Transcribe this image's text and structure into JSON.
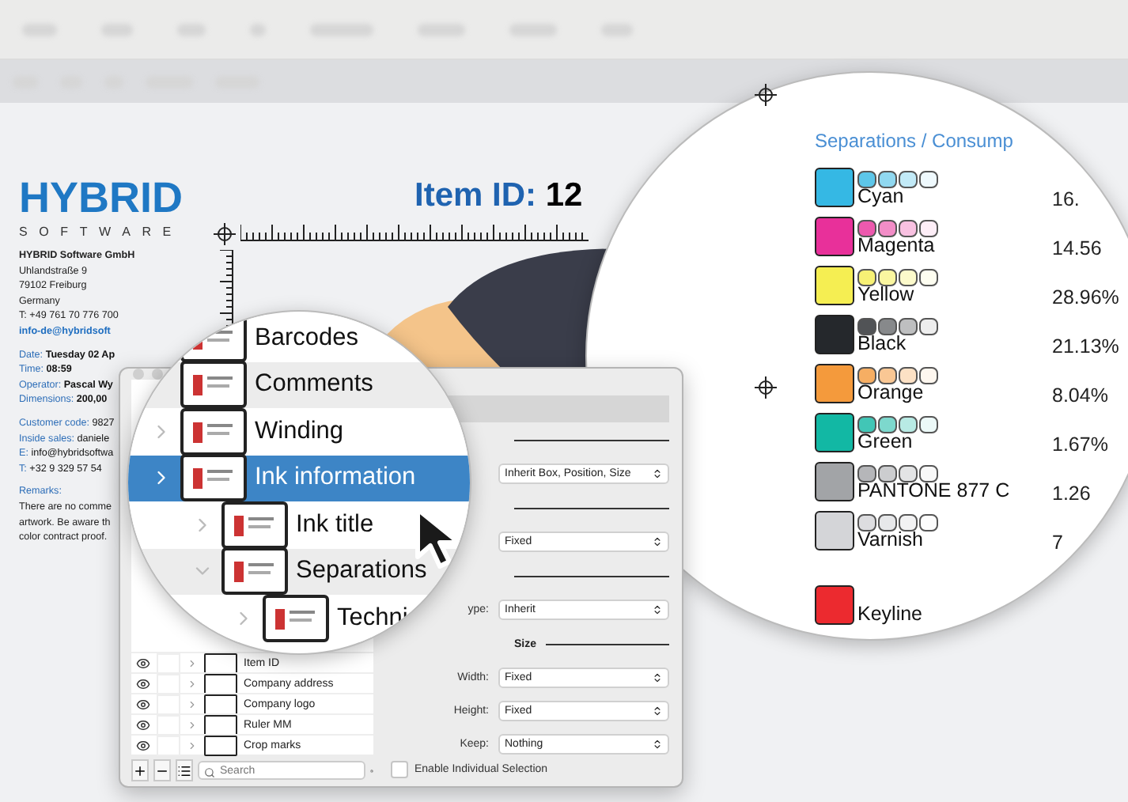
{
  "document": {
    "logo": {
      "name": "HYBRID",
      "tagline": "SOFTWARE"
    },
    "item_id": {
      "label": "Item ID:",
      "value": "12"
    },
    "address": [
      {
        "kind": "company",
        "text": "HYBRID Software GmbH"
      },
      {
        "kind": "line",
        "text": "Uhlandstraße 9"
      },
      {
        "kind": "line",
        "text": "79102 Freiburg"
      },
      {
        "kind": "line",
        "text": "Germany"
      },
      {
        "kind": "line",
        "text": "T: +49 761 70 776 700"
      },
      {
        "kind": "email",
        "text": "info-de@hybridsoft"
      }
    ],
    "details": [
      {
        "label": "Date:",
        "value": "Tuesday 02 Ap"
      },
      {
        "label": "Time:",
        "value": "08:59"
      },
      {
        "label": "Operator:",
        "value": "Pascal Wy"
      },
      {
        "label": "Dimensions:",
        "value": "200,00"
      }
    ],
    "contacts": [
      {
        "label": "Customer code:",
        "value": "9827"
      },
      {
        "label": "Inside sales:",
        "value": "daniele"
      },
      {
        "label": "E:",
        "value": "info@hybridsoftwa"
      },
      {
        "label": "T:",
        "value": "+32 9 329 57 54"
      }
    ],
    "remarks": {
      "label": "Remarks:",
      "lines": [
        "There are no comme",
        "artwork. Be aware th",
        "color contract proof."
      ]
    }
  },
  "layers_window": {
    "rows": [
      {
        "label": "Item ID"
      },
      {
        "label": "Company address"
      },
      {
        "label": "Company logo"
      },
      {
        "label": "Ruler MM"
      },
      {
        "label": "Crop marks"
      }
    ],
    "search": {
      "placeholder": "Search"
    },
    "properties": [
      {
        "kind": "section"
      },
      {
        "kind": "select",
        "value": "Inherit Box, Position, Size"
      },
      {
        "kind": "section"
      },
      {
        "kind": "select",
        "value": "Fixed"
      },
      {
        "kind": "section"
      },
      {
        "kind": "select",
        "label": "ype:",
        "value": "Inherit"
      },
      {
        "kind": "section",
        "title": "Size"
      },
      {
        "kind": "select",
        "label": "Width:",
        "value": "Fixed"
      },
      {
        "kind": "select",
        "label": "Height:",
        "value": "Fixed"
      },
      {
        "kind": "select",
        "label": "Keep:",
        "value": "Nothing"
      }
    ],
    "checkbox": {
      "label": "Enable Individual Selection",
      "checked": false
    }
  },
  "tree_magnifier": {
    "items": [
      {
        "label": "Barcodes",
        "selected": false
      },
      {
        "label": "Comments",
        "selected": false
      },
      {
        "label": "Winding",
        "selected": false,
        "expanded": false
      },
      {
        "label": "Ink information",
        "selected": true,
        "expanded": false,
        "children": [
          {
            "label": "Ink title",
            "selected": false,
            "expanded": false
          },
          {
            "label": "Separations",
            "selected": false,
            "expanded": true,
            "children": [
              {
                "label": "Techni",
                "selected": false,
                "expanded": false
              }
            ]
          }
        ]
      }
    ]
  },
  "separations_magnifier": {
    "title": "Separations / Consump",
    "inks": [
      {
        "kind": "process",
        "name": "Cyan",
        "color": "#35b8e4",
        "percent": "16."
      },
      {
        "kind": "process",
        "name": "Magenta",
        "color": "#e8309a",
        "percent": "14.56"
      },
      {
        "kind": "process",
        "name": "Yellow",
        "color": "#f5ee52",
        "percent": "28.96%"
      },
      {
        "kind": "process",
        "name": "Black",
        "color": "#25282c",
        "percent": "21.13%"
      },
      {
        "kind": "process",
        "name": "Orange",
        "color": "#f49a3c",
        "percent": "8.04%"
      },
      {
        "kind": "process",
        "name": "Green",
        "color": "#12b8a4",
        "percent": "1.67%"
      },
      {
        "kind": "process",
        "name": "PANTONE 877 C",
        "color": "#a2a4a7",
        "percent": "1.26"
      },
      {
        "kind": "process",
        "name": "Varnish",
        "color": "#d4d5d8",
        "percent": "7"
      },
      {
        "kind": "technical",
        "name": "Keyline",
        "color": "#ec2a2f"
      }
    ]
  }
}
